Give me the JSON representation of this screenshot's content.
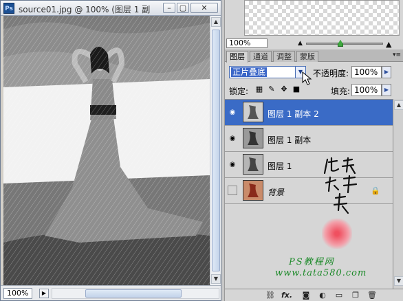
{
  "document": {
    "title": "source01.jpg @ 100% (图层 1 副...",
    "logo": "Ps",
    "zoom": "100%",
    "icons": [
      "minimize-icon",
      "maximize-icon",
      "close-icon"
    ]
  },
  "navigator": {
    "zoom": "100%"
  },
  "layers_panel": {
    "tabs": [
      {
        "label": "图层",
        "active": true
      },
      {
        "label": "通道",
        "active": false
      },
      {
        "label": "调整",
        "active": false
      },
      {
        "label": "蒙版",
        "active": false
      }
    ],
    "blend_mode": "正片叠底",
    "opacity_label": "不透明度:",
    "opacity": "100%",
    "lock_label": "锁定:",
    "fill_label": "填充:",
    "fill": "100%",
    "layers": [
      {
        "name": "图层 1 副本 2",
        "visible": true,
        "selected": true,
        "italic": false
      },
      {
        "name": "图层 1 副本",
        "visible": true,
        "selected": false,
        "italic": false
      },
      {
        "name": "图层 1",
        "visible": true,
        "selected": false,
        "italic": false
      },
      {
        "name": "背景",
        "visible": false,
        "selected": false,
        "italic": true,
        "locked": true
      }
    ],
    "footer_icons": [
      "link-icon",
      "fx-icon",
      "mask-icon",
      "adjustment-icon",
      "group-icon",
      "new-layer-icon",
      "trash-icon"
    ]
  },
  "watermark": {
    "site_name": "PS教程网",
    "site_url": "www.tata580.com"
  },
  "colors": {
    "selection": "#3a6bc6",
    "panel_bg": "#d6d6d6",
    "watermark_green": "#1d8a2a"
  }
}
